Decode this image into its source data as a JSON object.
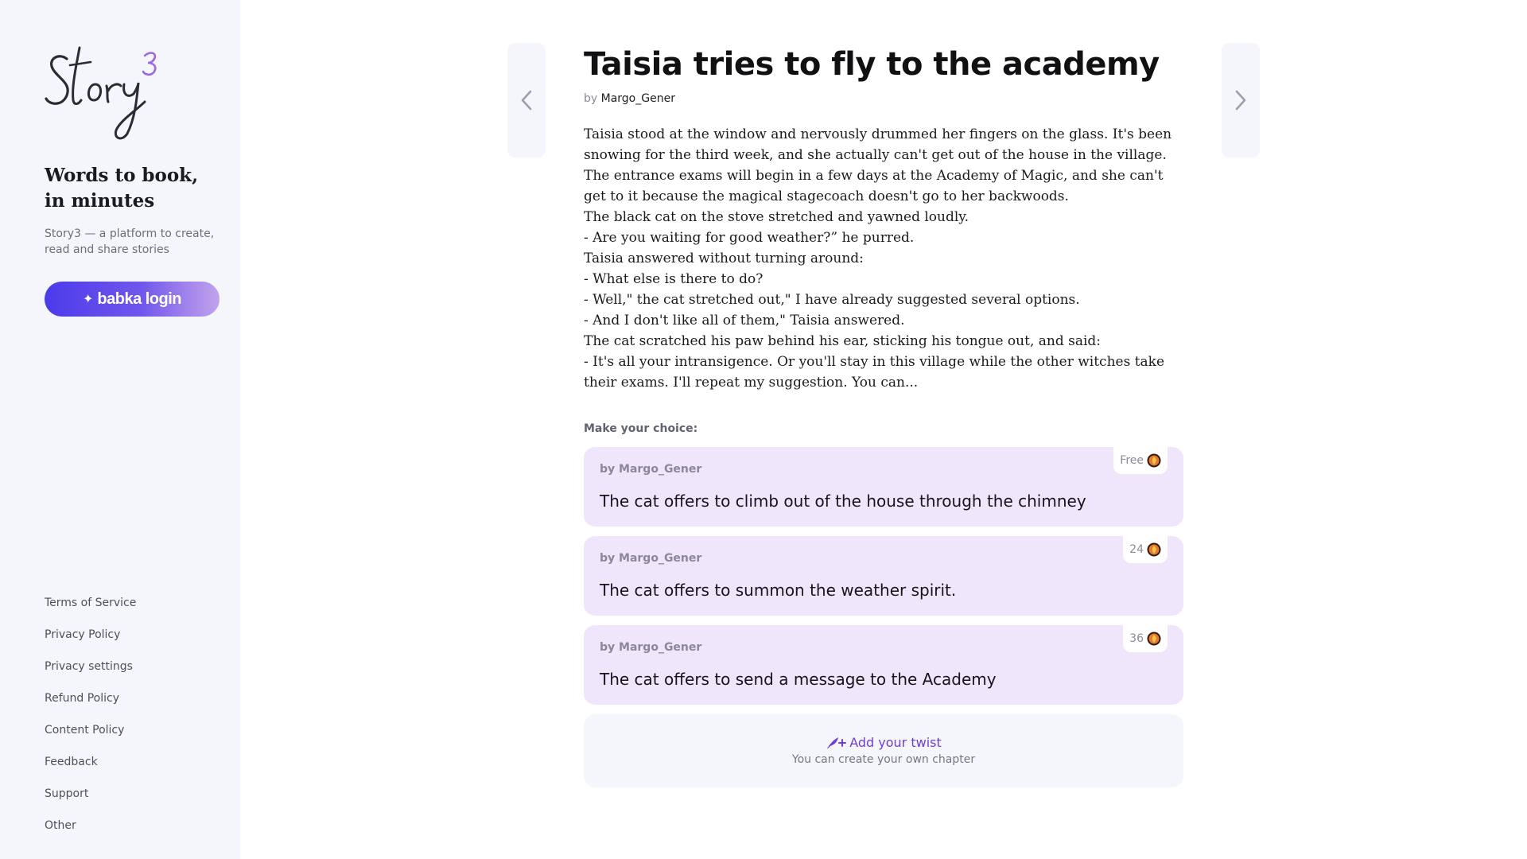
{
  "sidebar": {
    "logo_text": "story3",
    "tagline_line1": "Words to book,",
    "tagline_line2": "in minutes",
    "description": "Story3 — a platform to create, read and share stories",
    "login_label": "babka login",
    "footer_links": [
      "Terms of Service",
      "Privacy Policy",
      "Privacy settings",
      "Refund Policy",
      "Content Policy",
      "Feedback",
      "Support",
      "Other"
    ]
  },
  "story": {
    "title": "Taisia tries to fly to the academy",
    "by_prefix": "by",
    "author": "Margo_Gener",
    "paragraphs": [
      "Taisia stood at the window and nervously drummed her fingers on the glass. It's been snowing for the third week, and she actually can't get out of the house in the village. The entrance exams will begin in a few days at the Academy of Magic, and she can't get to it because the magical stagecoach doesn't go to her backwoods.",
      "The black cat on the stove stretched and yawned loudly.",
      "- Are you waiting for good weather?” he purred.",
      "Taisia answered without turning around:",
      "- What else is there to do?",
      "- Well,\" the cat stretched out,\" I have already suggested several options.",
      "- And I don't like all of them,\" Taisia answered.",
      "The cat scratched his paw behind his ear, sticking his tongue out, and said:",
      "- It's all your intransigence. Or you'll stay in this village while the other witches take their exams. I'll repeat my suggestion. You can..."
    ]
  },
  "choices": {
    "header": "Make your choice:",
    "items": [
      {
        "author": "by Margo_Gener",
        "text": "The cat offers to climb out of the house through the chimney",
        "price": "Free"
      },
      {
        "author": "by Margo_Gener",
        "text": "The cat offers to summon the weather spirit.",
        "price": "24"
      },
      {
        "author": "by Margo_Gener",
        "text": "The cat offers to send a message to the Academy",
        "price": "36"
      }
    ],
    "coin_icon": "coin-icon"
  },
  "twist": {
    "title": "Add your twist",
    "subtitle": "You can create your own chapter",
    "icon": "quill-sparkle-icon"
  },
  "colors": {
    "accent": "#6e3fd6",
    "card_bg": "#efe6fb",
    "sidebar_bg": "#f4f6fc",
    "login_gradient_start": "#4b3bea",
    "login_gradient_end": "#c2a3ec"
  }
}
